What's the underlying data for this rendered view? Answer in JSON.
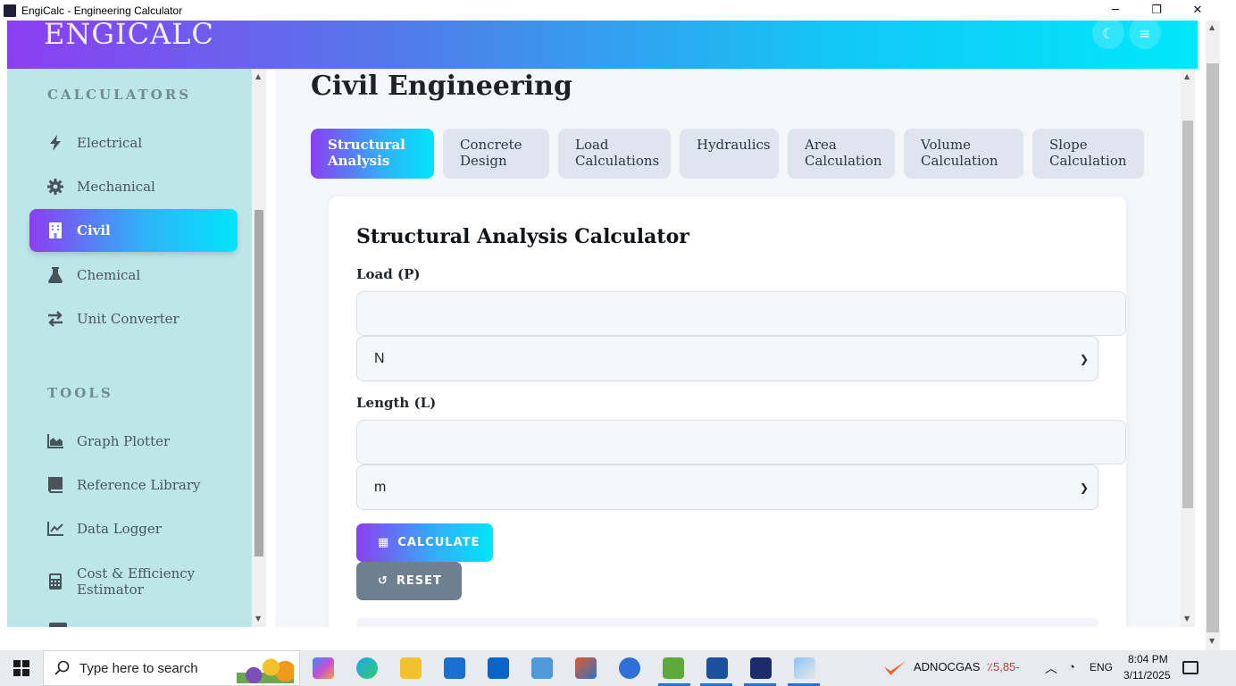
{
  "window": {
    "title": "EngiCalc - Engineering Calculator",
    "minimize": "─",
    "maximize": "❐",
    "close": "✕"
  },
  "header": {
    "logo": "ENGICALC",
    "theme_icon": "☾",
    "menu_icon": "≡"
  },
  "sidebar": {
    "calculators_title": "CALCULATORS",
    "tools_title": "TOOLS",
    "calculators": [
      {
        "label": "Electrical",
        "icon": "bolt-icon"
      },
      {
        "label": "Mechanical",
        "icon": "gear-icon"
      },
      {
        "label": "Civil",
        "icon": "building-icon",
        "active": true
      },
      {
        "label": "Chemical",
        "icon": "flask-icon"
      },
      {
        "label": "Unit Converter",
        "icon": "exchange-icon"
      }
    ],
    "tools": [
      {
        "label": "Graph Plotter",
        "icon": "area-chart-icon"
      },
      {
        "label": "Reference Library",
        "icon": "book-icon"
      },
      {
        "label": "Data Logger",
        "icon": "line-chart-icon"
      },
      {
        "label": "Cost & Efficiency Estimator",
        "icon": "calculator-icon"
      }
    ]
  },
  "main": {
    "page_title": "Civil Engineering",
    "tabs": [
      {
        "label": "Structural Analysis",
        "active": true
      },
      {
        "label": "Concrete Design"
      },
      {
        "label": "Load Calculations"
      },
      {
        "label": "Hydraulics"
      },
      {
        "label": "Area Calculation"
      },
      {
        "label": "Volume Calculation"
      },
      {
        "label": "Slope Calculation"
      }
    ],
    "card": {
      "title": "Structural Analysis Calculator",
      "load_label": "Load (P)",
      "load_value": "",
      "load_unit": "N",
      "length_label": "Length (L)",
      "length_value": "",
      "length_unit": "m",
      "calculate_label": "CALCULATE",
      "reset_label": "RESET"
    }
  },
  "taskbar": {
    "search_placeholder": "Type here to search",
    "stock_name": "ADNOCGAS",
    "stock_change": "٪5,85-",
    "lang": "ENG",
    "time": "8:04 PM",
    "date": "3/11/2025"
  },
  "colors": {
    "accent_start": "#8b3ff2",
    "accent_end": "#00e6fb",
    "sidebar_bg": "#bde6e8",
    "reset_btn": "#6e7f90",
    "stock_negative": "#c0392b"
  }
}
